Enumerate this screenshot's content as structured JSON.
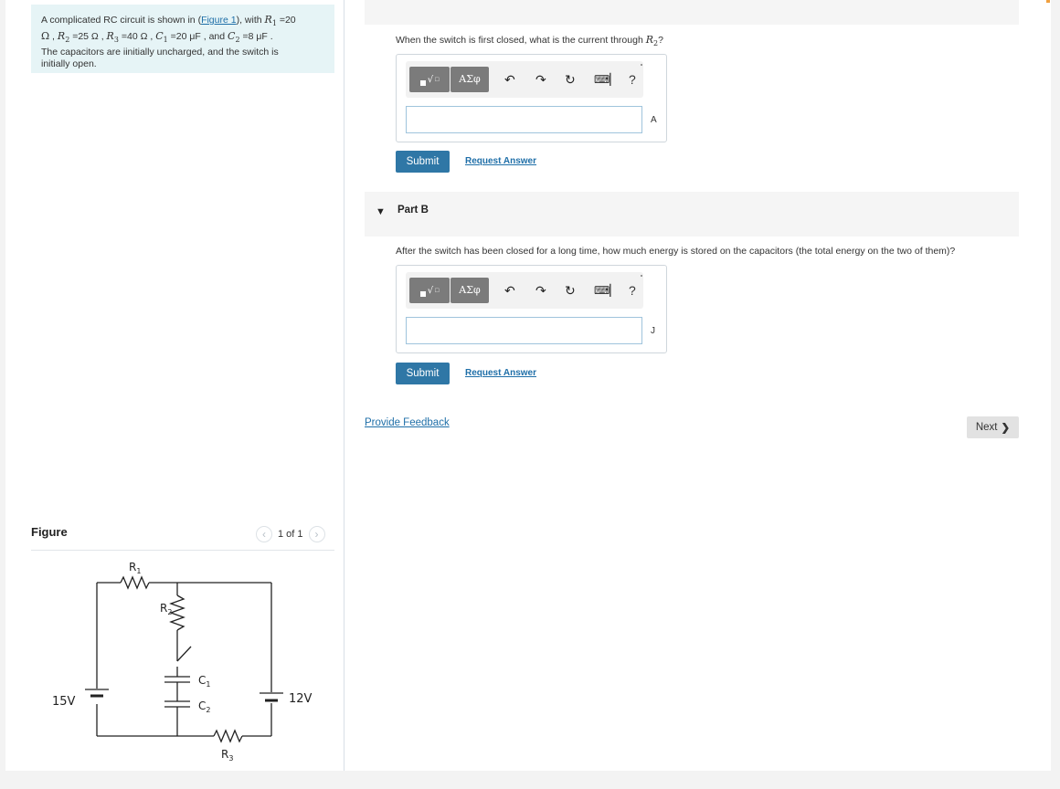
{
  "problem": {
    "text_intro": "A complicated RC circuit is shown in (",
    "figure_link": "Figure 1",
    "text_with": "), with ",
    "r1_sym": "R",
    "r1_sub": "1",
    "r1_val": " =20",
    "unit_ohm_1": "Ω",
    "r2_sym": "R",
    "r2_sub": "2",
    "r2_val": " =25 Ω",
    "r3_sym": "R",
    "r3_sub": "3",
    "r3_val": " =40 Ω",
    "c1_sym": "C",
    "c1_sub": "1",
    "c1_val": " =20 μF",
    "and_text": " , and ",
    "c2_sym": "C",
    "c2_sub": "2",
    "c2_val": " =8 μF",
    "period": " .",
    "text_line3": "The capacitors are iinitially uncharged, and the switch is",
    "text_line4": "initially open."
  },
  "figure": {
    "title": "Figure",
    "pager_text": "1 of 1",
    "prev_icon": "chevron-left-icon",
    "next_icon": "chevron-right-icon",
    "labels": {
      "r1": "R",
      "r1_sub": "1",
      "r2": "R",
      "r2_sub": "2",
      "r3": "R",
      "r3_sub": "3",
      "c1": "C",
      "c1_sub": "1",
      "c2": "C",
      "c2_sub": "2",
      "v_left": "15V",
      "v_right": "12V"
    }
  },
  "part_a": {
    "question_prefix": "When the switch is first closed, what is the current through ",
    "question_sym": "R",
    "question_sub": "2",
    "question_suffix": "?",
    "unit": "A",
    "submit_label": "Submit",
    "request_label": "Request Answer"
  },
  "part_b": {
    "header": "Part B",
    "question": "After the switch has been closed for a long time, how much energy is stored on the capacitors (the total energy on the two of them)?",
    "unit": "J",
    "submit_label": "Submit",
    "request_label": "Request Answer"
  },
  "toolbar": {
    "greek_label": "AΣφ",
    "help_label": "?",
    "icons": [
      "templates-icon",
      "greek-symbols-icon",
      "undo-icon",
      "redo-icon",
      "reset-icon",
      "keyboard-icon",
      "help-icon"
    ]
  },
  "footer": {
    "feedback_label": "Provide Feedback",
    "next_label": "Next"
  }
}
